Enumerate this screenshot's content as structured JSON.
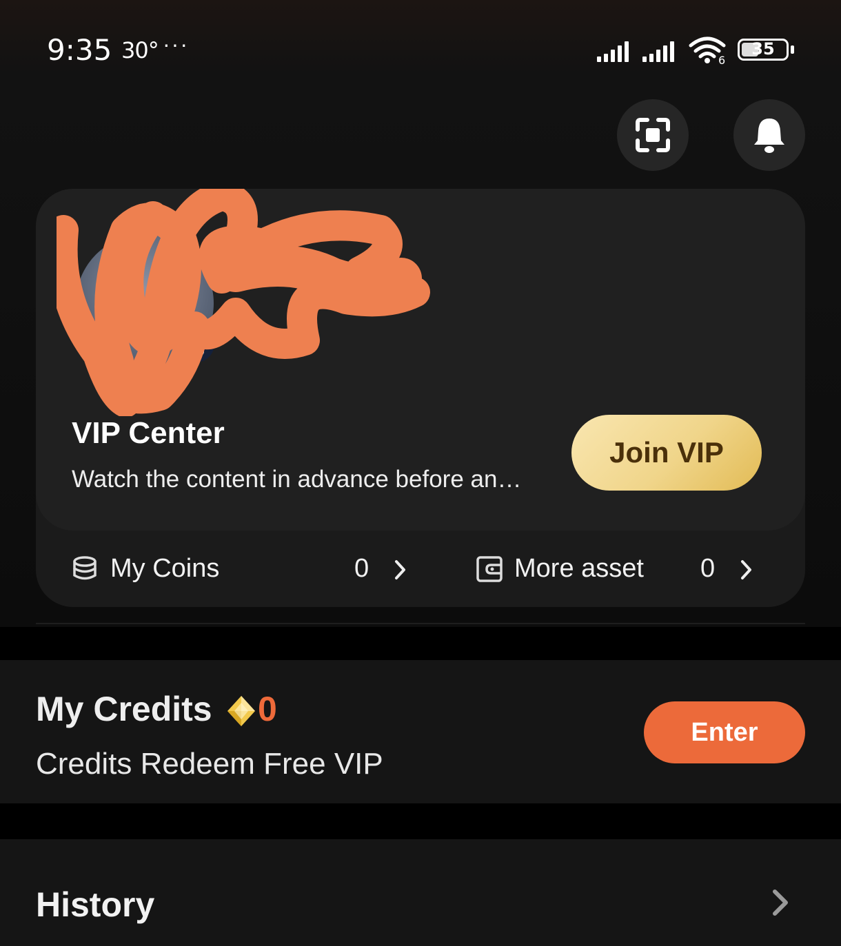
{
  "status_bar": {
    "time": "9:35",
    "temperature": "30°",
    "more": "···",
    "battery": "35",
    "wifi_badge": "6"
  },
  "header": {
    "scan_icon": "scan-icon",
    "bell_icon": "bell-icon"
  },
  "profile": {
    "vip_title": "VIP Center",
    "vip_desc": "Watch the content in advance before an…",
    "join_label": "Join VIP",
    "coins_label": "My Coins",
    "coins_value": "0",
    "asset_label": "More asset",
    "asset_value": "0"
  },
  "credits": {
    "title": "My Credits",
    "value": "0",
    "subtitle": "Credits Redeem Free VIP",
    "enter_label": "Enter"
  },
  "history": {
    "title": "History"
  },
  "colors": {
    "accent_orange": "#ec6a3a",
    "gold": "#f0d58a",
    "redaction": "#ee8050"
  }
}
